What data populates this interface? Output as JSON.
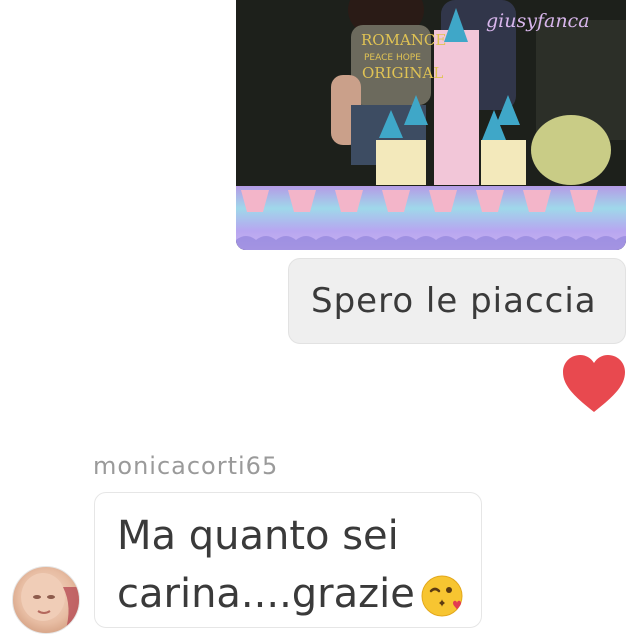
{
  "photo": {
    "watermark": "giusyfanca",
    "shirt_text_top": "ROMANCE",
    "shirt_text_mid": "PEACE HOPE",
    "shirt_text_bottom": "ORIGINAL"
  },
  "messages": {
    "outgoing_text": "Spero le piaccia",
    "incoming_username": "monicacorti65",
    "incoming_line1": "Ma quanto sei",
    "incoming_line2": "carina....grazie"
  },
  "icons": {
    "reaction": "heart-icon",
    "emoji": "kiss-wink-emoji-icon"
  },
  "colors": {
    "heart": "#e8494f",
    "bubble_grey": "#efefef",
    "text": "#3a3a3a",
    "username": "#9a9a9a"
  }
}
